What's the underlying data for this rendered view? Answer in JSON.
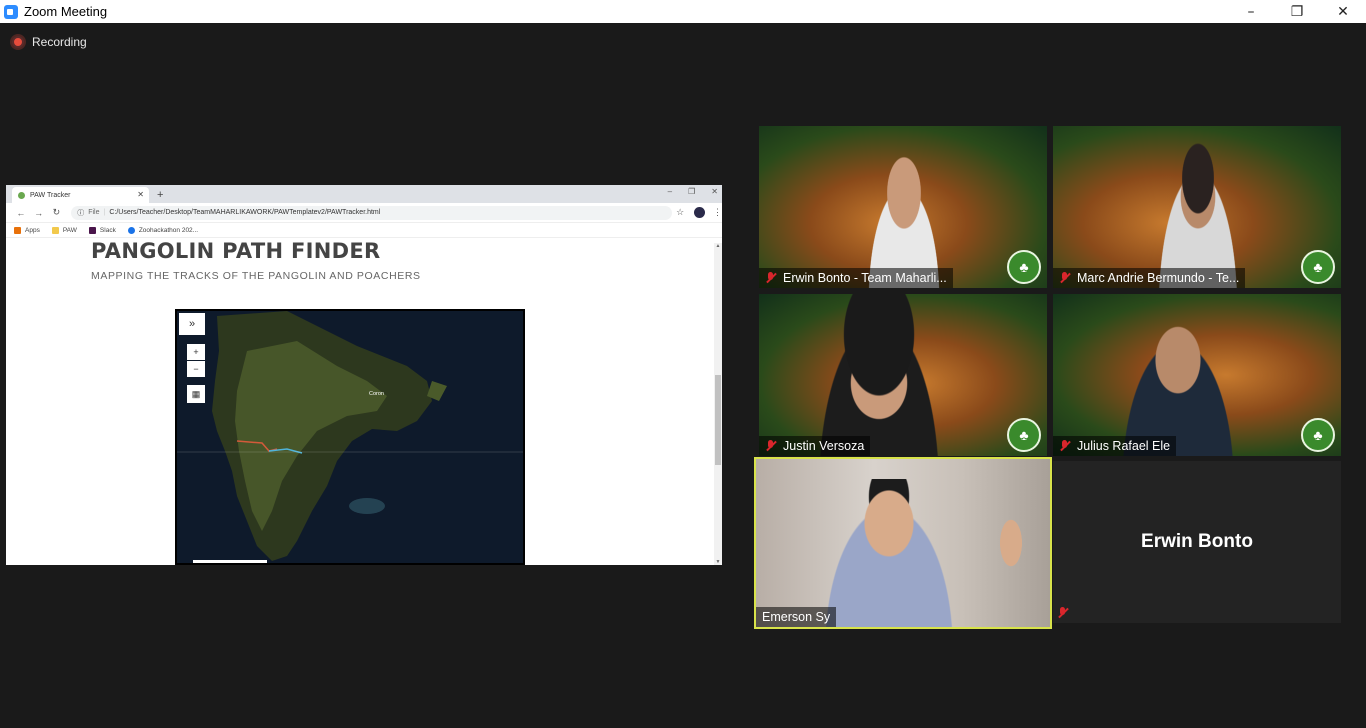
{
  "window": {
    "title": "Zoom Meeting",
    "controls": [
      "–",
      "❐",
      "✕"
    ]
  },
  "recording": {
    "label": "Recording"
  },
  "shared_screen": {
    "browser": {
      "tab_title": "PAW Tracker",
      "tab_close": "✕",
      "new_tab": "+",
      "window_controls": [
        "–",
        "❐",
        "✕"
      ],
      "nav": {
        "back": "←",
        "forward": "→",
        "reload": "↻",
        "info": "ⓘ"
      },
      "file_label": "File",
      "url": "C:/Users/Teacher/Desktop/TeamMAHARLIKAWORK/PAWTemplatev2/PAWTracker.html",
      "bookmarks": [
        {
          "label": "Apps",
          "color": "#e8710a"
        },
        {
          "label": "PAW",
          "color": "#f2c94c"
        },
        {
          "label": "Slack",
          "color": "#4a154b"
        },
        {
          "label": "Zoohackathon 202...",
          "color": "#1a73e8"
        }
      ]
    },
    "page": {
      "title": "PANGOLIN PATH FINDER",
      "subtitle": "MAPPING THE TRACKS OF THE PANGOLIN AND POACHERS",
      "map": {
        "layers_button": "»",
        "zoom_in": "+",
        "zoom_out": "−",
        "qr_button": "▦",
        "place_label": "Coron"
      }
    }
  },
  "participants": [
    {
      "name": "Erwin Bonto - Team Maharli...",
      "muted": true,
      "video": true,
      "active": false
    },
    {
      "name": "Marc Andrie Bermundo - Te...",
      "muted": true,
      "video": true,
      "active": false
    },
    {
      "name": "Justin Versoza",
      "muted": true,
      "video": true,
      "active": false
    },
    {
      "name": "Julius Rafael Ele",
      "muted": true,
      "video": true,
      "active": false
    },
    {
      "name": "Emerson Sy",
      "muted": false,
      "video": true,
      "active": true
    },
    {
      "name": "Erwin Bonto",
      "muted": true,
      "video": false,
      "active": false
    }
  ],
  "colors": {
    "active_speaker_border": "#d8e34a",
    "muted_icon": "#d9262c",
    "recording_dot": "#e74c3c"
  }
}
